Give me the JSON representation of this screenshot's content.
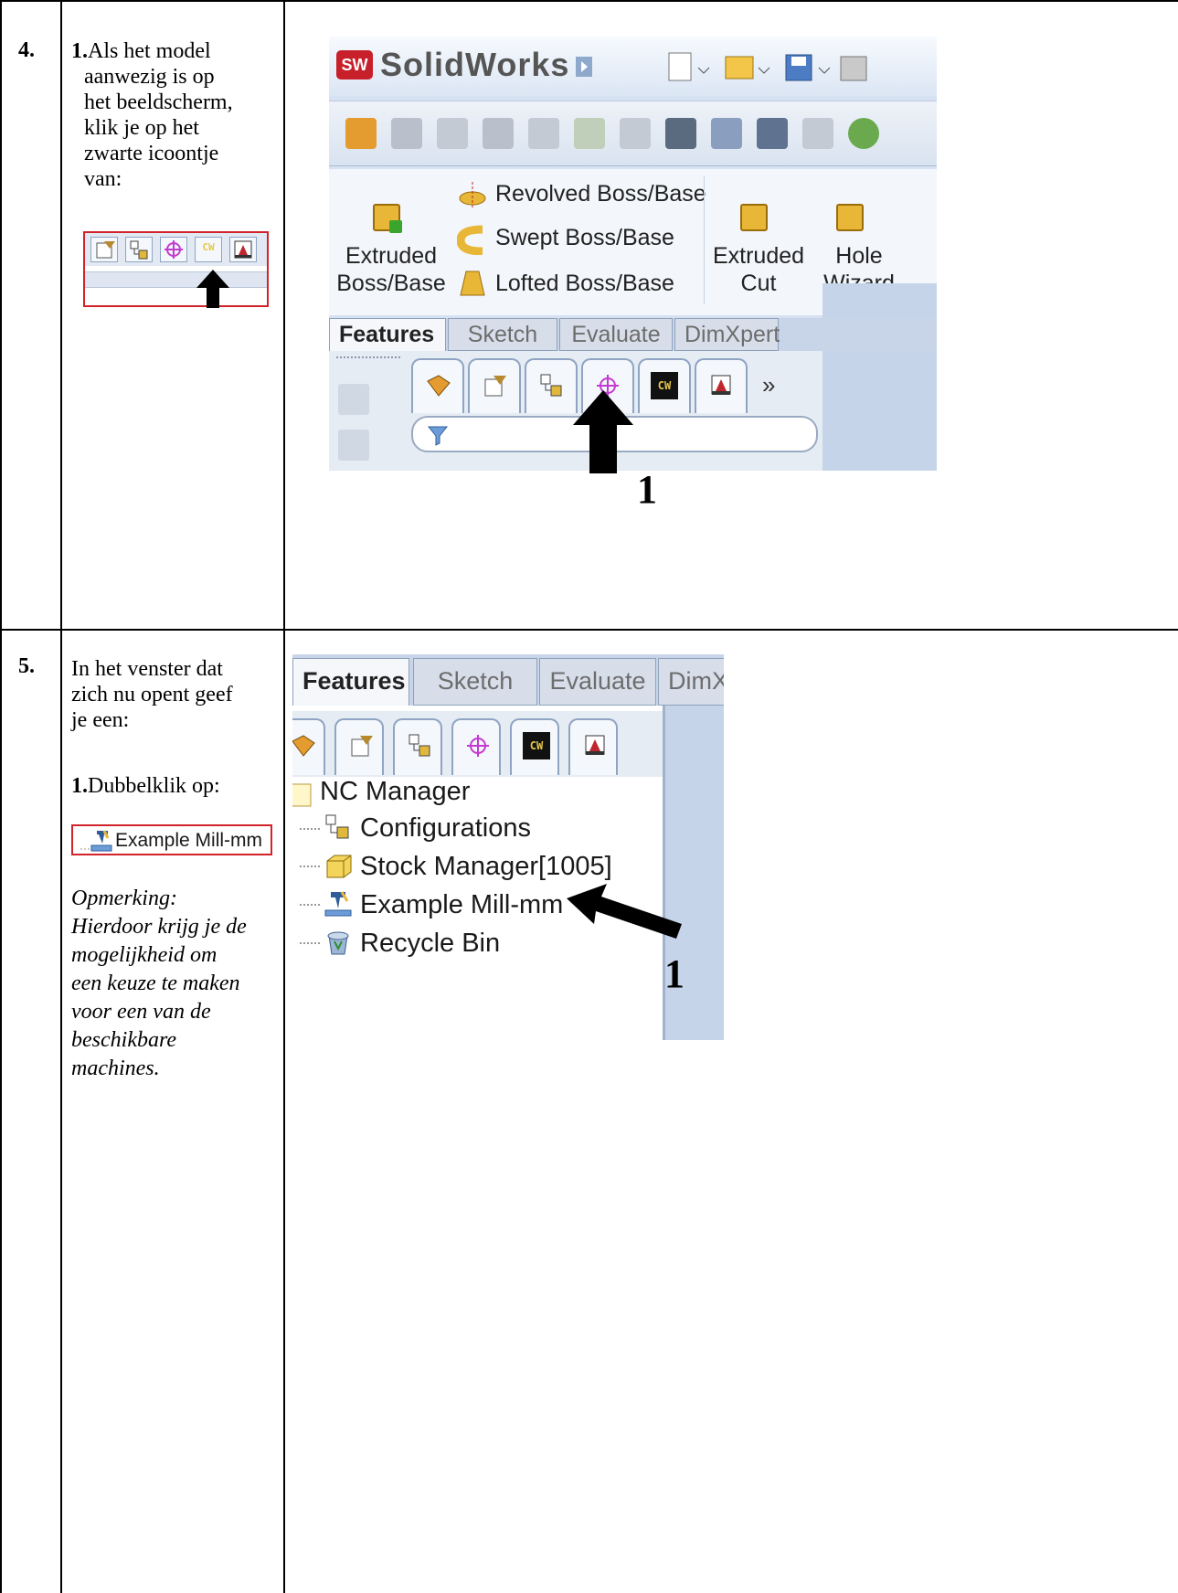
{
  "steps": [
    {
      "number": "4.",
      "text": {
        "lead": "1.",
        "body": "Als het model aanwezig is op het beeldscherm, klik je op het zwarte icoontje van:",
        "lines": [
          "Als het model",
          "aanwezig is op",
          "het beeldscherm,",
          "klik je op het",
          "zwarte icoontje",
          "van:"
        ]
      },
      "screenshot": {
        "app_title": "SolidWorks",
        "logo": "SW",
        "ribbon": {
          "extruded_boss": "Extruded",
          "extruded_boss_2": "Boss/Base",
          "revolved": "Revolved Boss/Base",
          "swept": "Swept Boss/Base",
          "lofted": "Lofted Boss/Base",
          "extruded_cut": "Extruded",
          "extruded_cut_2": "Cut",
          "hole": "Hole",
          "hole_2": "Wizard"
        },
        "tabs": [
          "Features",
          "Sketch",
          "Evaluate",
          "DimXpert"
        ],
        "overflow": "»",
        "callout": "1",
        "cw_icon_label": "CW"
      }
    },
    {
      "number": "5.",
      "text": {
        "lines": [
          "In het venster dat",
          "zich nu opent geef",
          "je een:"
        ],
        "instruction_lead": "1.",
        "instruction": "Dubbelklik op:",
        "note_lines": [
          "Opmerking:",
          "Hierdoor krijg je de",
          "mogelijkheid om",
          "een keuze te maken",
          "voor een van de",
          "beschikbare",
          "machines."
        ]
      },
      "screenshot": {
        "tabs": [
          "Features",
          "Sketch",
          "Evaluate",
          "DimX"
        ],
        "tree": [
          "NC Manager",
          "Configurations",
          "Stock Manager[1005]",
          "Example Mill-mm",
          "Recycle Bin"
        ],
        "highlight": "Example Mill-mm",
        "callout": "1",
        "cw_icon_label": "CW"
      }
    }
  ],
  "colors": {
    "highlight_border": "#d2232a",
    "solidworks_red": "#c8202a",
    "panel_blue": "#c5d4e8"
  }
}
